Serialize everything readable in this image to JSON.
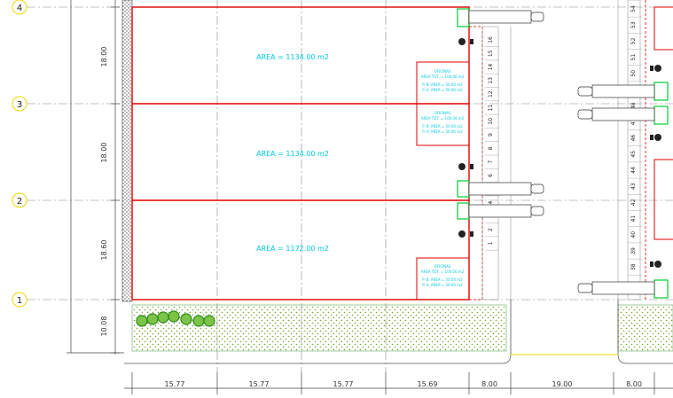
{
  "colors": {
    "wall": "#e00000",
    "dim": "#444444",
    "grid": "#777777",
    "area_text": "#00c8e0",
    "grid_bubble": "#e8d800",
    "green_hatch": "#6fa82e",
    "tree": "#3aa020",
    "parking_dash": "#e00000",
    "green_box": "#00cc33",
    "yellow_line": "#e8d800"
  },
  "grid_bubbles": [
    "4",
    "3",
    "2",
    "1"
  ],
  "vertical_dims": [
    "18.00",
    "18.00",
    "18.60",
    "10.08"
  ],
  "areas": [
    "AREA = 1134.00  m2",
    "AREA = 1134.00  m2",
    "AREA = 1172.00  m2"
  ],
  "bottom_dims": [
    "15.77",
    "15.77",
    "15.77",
    "15.69",
    "8.00",
    "19.00",
    "8.00"
  ],
  "office_label": [
    "OFICINAS",
    "AREA TOT. = 100.00 m2",
    "P. B. AREA = 50.00 m2",
    "P. A. AREA = 50.00 m2"
  ],
  "parking_left": [
    "16",
    "15",
    "14",
    "13",
    "12",
    "11",
    "10",
    "9",
    "8",
    "7",
    "6",
    "5",
    "4",
    "3",
    "2",
    "1"
  ],
  "parking_right": [
    "54",
    "53",
    "52",
    "51",
    "50",
    "49",
    "48",
    "47",
    "46",
    "45",
    "44",
    "43",
    "42",
    "41",
    "40",
    "39",
    "38"
  ]
}
